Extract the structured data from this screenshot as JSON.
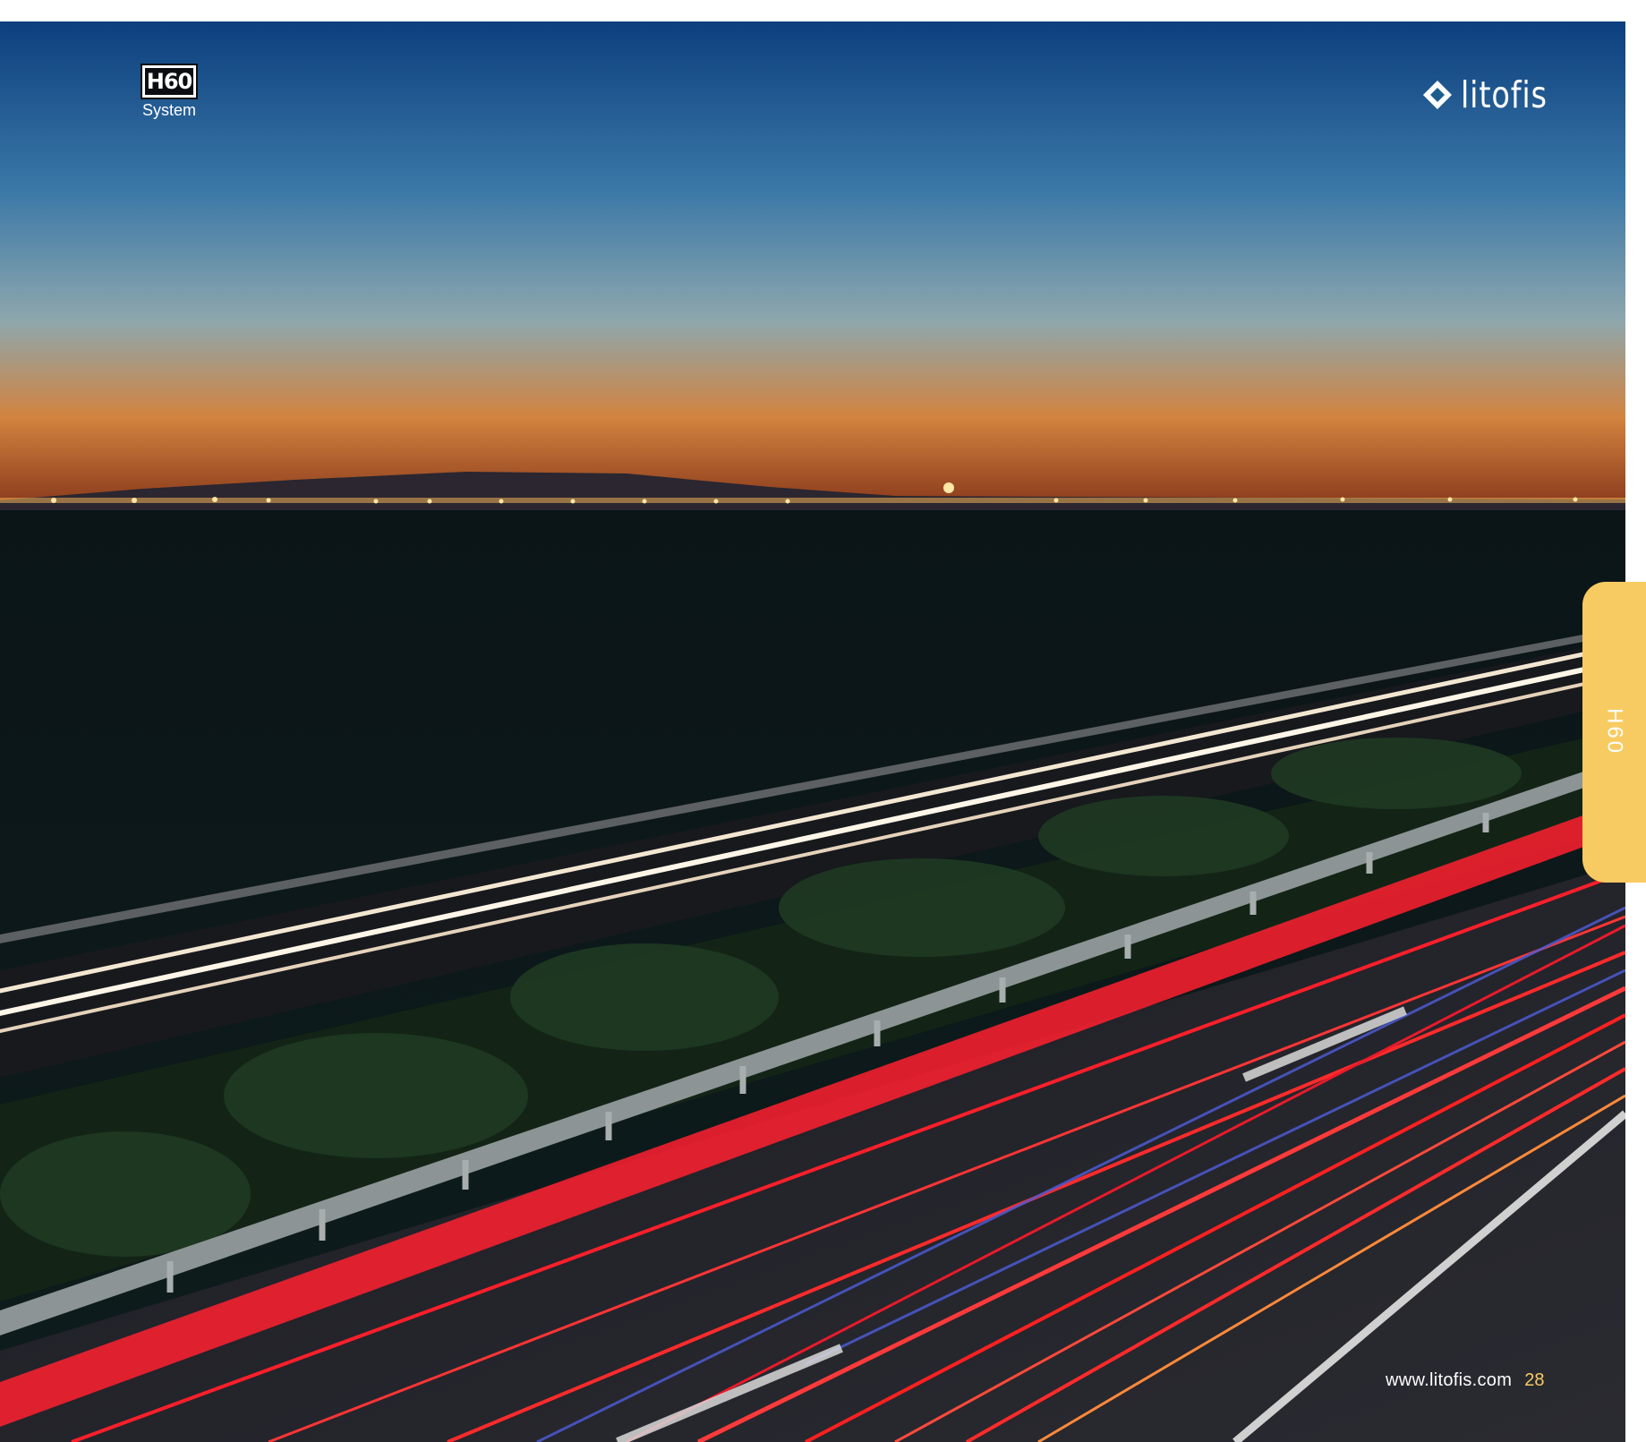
{
  "header": {
    "badge_label": "H60",
    "badge_sublabel": "System",
    "brand_name": "litofis"
  },
  "side_tab": {
    "label": "H60"
  },
  "footer": {
    "url": "www.litofis.com",
    "page_number": "28"
  },
  "colors": {
    "accent": "#f8cb62",
    "night_sky_top": "#0c3f7e",
    "sunset_glow": "#d2833e",
    "ground": "#0b1518",
    "tail_lights": "#ff1f2a"
  },
  "photo": {
    "icon": "night-highway-light-trails-photo"
  }
}
